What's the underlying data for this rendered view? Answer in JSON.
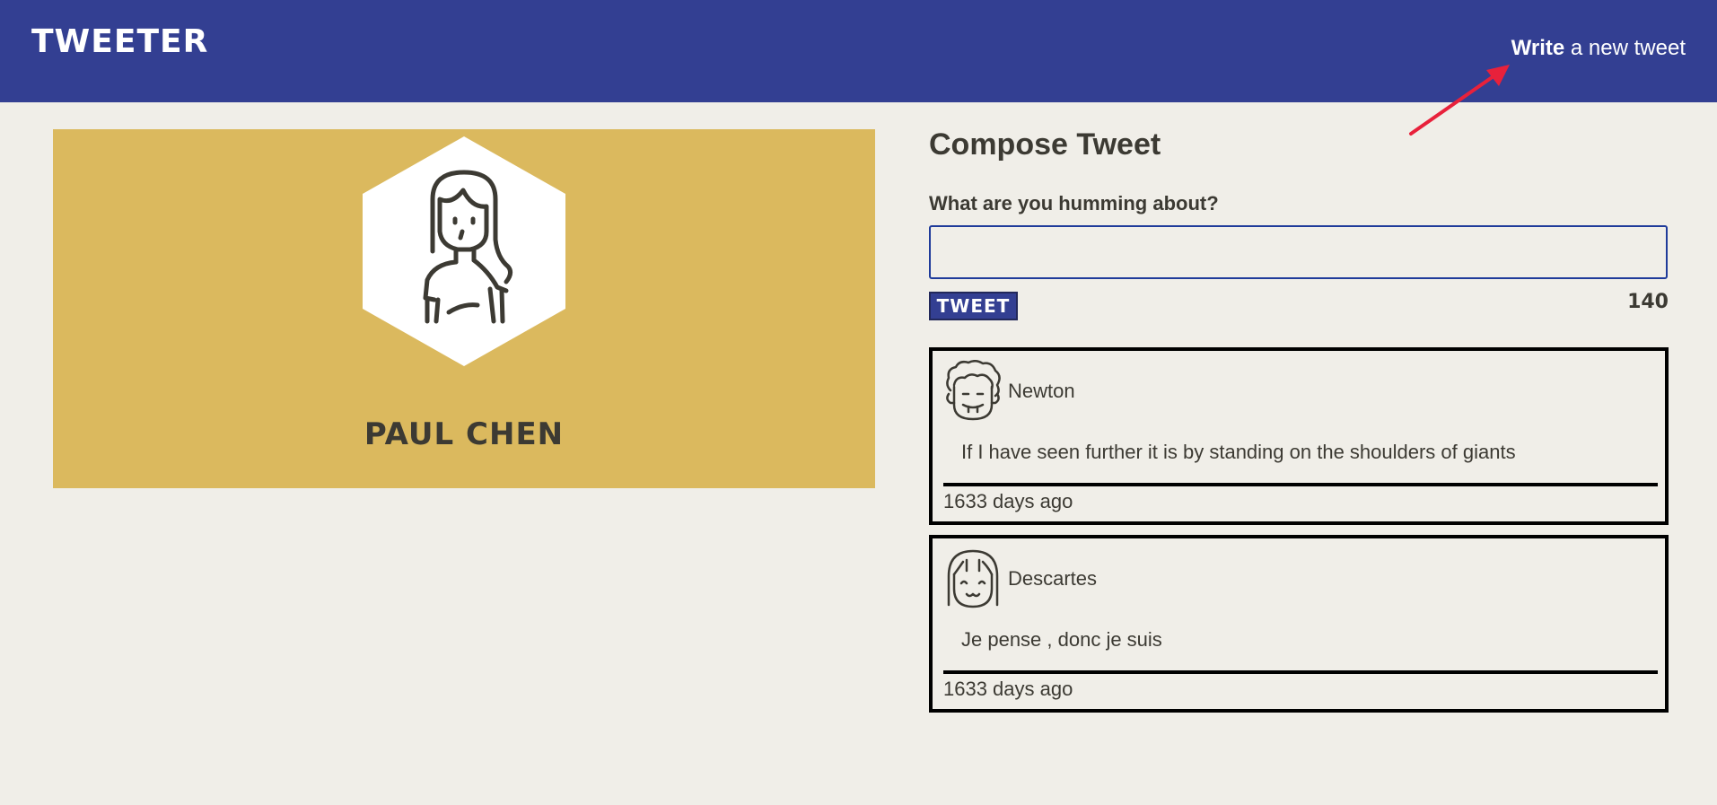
{
  "navbar": {
    "brand": "TWEETER",
    "link_bold": "Write",
    "link_rest": " a new tweet",
    "background": "#333f92",
    "annotation_color": "#e8213b"
  },
  "profile": {
    "name": "PAUL CHEN",
    "avatar_icon": "woman-avatar-icon",
    "card_color": "#dbb95e"
  },
  "compose": {
    "title": "Compose Tweet",
    "label": "What are you humming about?",
    "input_value": "",
    "button_label": "TWEET",
    "char_count": "140"
  },
  "tweets": [
    {
      "handle": "Newton",
      "avatar_icon": "curly-hair-man-avatar-icon",
      "text": "If I have seen further it is by standing on the shoulders of giants",
      "time": "1633 days ago"
    },
    {
      "handle": "Descartes",
      "avatar_icon": "bob-hair-avatar-icon",
      "text": "Je pense , donc je suis",
      "time": "1633 days ago"
    }
  ]
}
